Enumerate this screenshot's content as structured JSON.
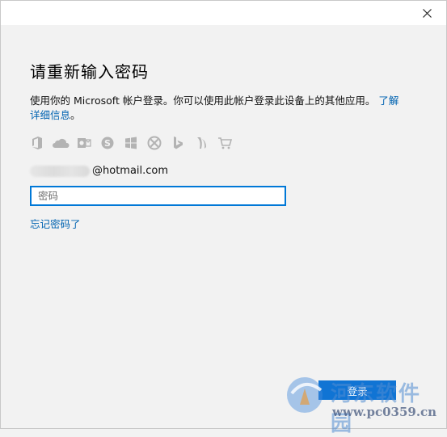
{
  "dialog": {
    "title": "请重新输入密码",
    "description": "使用你的 Microsoft 帐户登录。你可以使用此帐户登录此设备上的其他应用。",
    "learn_more_link": "了解详细信息",
    "description_end": "。",
    "account_suffix": "@hotmail.com",
    "password_placeholder": "密码",
    "forgot_link": "忘记密码了",
    "signin_button": "登录",
    "close_label": "×"
  },
  "services": [
    {
      "name": "office-icon"
    },
    {
      "name": "onedrive-icon"
    },
    {
      "name": "outlook-icon"
    },
    {
      "name": "skype-icon"
    },
    {
      "name": "windows-icon"
    },
    {
      "name": "xbox-icon"
    },
    {
      "name": "bing-icon"
    },
    {
      "name": "msn-icon"
    },
    {
      "name": "store-icon"
    }
  ],
  "watermark": {
    "text": "河东软件园",
    "url": "www.pc0359.cn"
  },
  "colors": {
    "accent": "#0078d7",
    "link": "#0063b1",
    "button": "#1074d4",
    "background": "#f2f2f2",
    "icon_gray": "#b3b3b3"
  }
}
